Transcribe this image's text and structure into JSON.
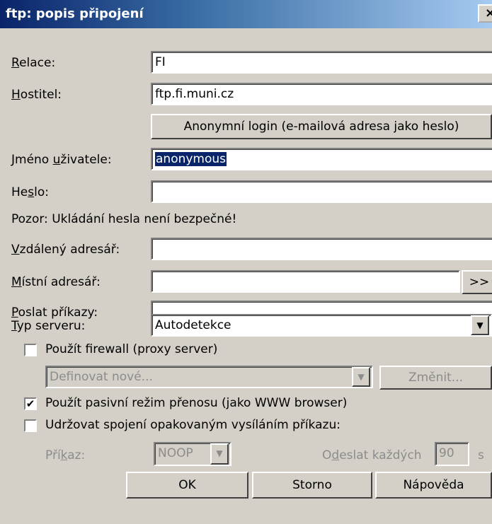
{
  "window": {
    "title": "ftp: popis připojení",
    "close": "×"
  },
  "form": {
    "session_label": "Relace:",
    "session_value": "FI",
    "host_label": "Hostitel:",
    "host_value": "ftp.fi.muni.cz",
    "anon_button": "Anonymní login (e-mailová adresa jako heslo)",
    "user_label": "Jméno uživatele:",
    "user_value": "anonymous",
    "password_label": "Heslo:",
    "password_value": "",
    "warning": "Pozor: Ukládání hesla není bezpečné!",
    "remote_dir_label": "Vzdálený adresář:",
    "remote_dir_value": "",
    "local_dir_label": "Místní adresář:",
    "local_dir_value": "",
    "browse_button": ">>",
    "send_cmds_label": "Poslat příkazy:",
    "send_cmds_value": "",
    "server_type_label": "Typ serveru:",
    "server_type_value": "Autodetekce",
    "firewall_checkbox_label": "Použít firewall (proxy server)",
    "firewall_checked": false,
    "firewall_select_value": "Definovat nové...",
    "firewall_change_button": "Změnit...",
    "passive_checkbox_label": "Použít pasivní režim přenosu (jako WWW browser)",
    "passive_checked": true,
    "keepalive_checkbox_label": "Udržovat spojení opakovaným vysíláním příkazu:",
    "keepalive_checked": false,
    "command_label": "Příkaz:",
    "command_value": "NOOP",
    "send_every_label": "Odeslat každých",
    "send_every_value": "90",
    "send_every_unit": "s"
  },
  "buttons": {
    "ok": "OK",
    "cancel": "Storno",
    "help": "Nápověda"
  },
  "colors": {
    "titlebar_start": "#0a246a",
    "titlebar_end": "#a6caf0",
    "dialog_bg": "#d4d0c8"
  }
}
